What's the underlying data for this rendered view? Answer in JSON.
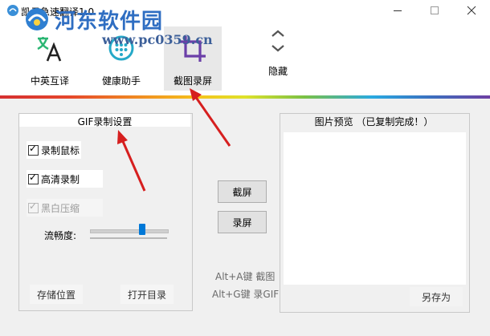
{
  "window": {
    "title": "凯云急速翻译1.0",
    "watermark_text": "河东软件园",
    "watermark_url": "www.pc0359.cn"
  },
  "toolbar": {
    "translate_label": "中英互译",
    "health_label": "健康助手",
    "capture_label": "截图录屏",
    "hide_label": "隐藏"
  },
  "gif_settings": {
    "title": "GIF录制设置",
    "record_mouse": {
      "label": "录制鼠标",
      "checked": true,
      "enabled": true
    },
    "hd_record": {
      "label": "高清录制",
      "checked": true,
      "enabled": true
    },
    "bw_compress": {
      "label": "黑白压缩",
      "checked": true,
      "enabled": false
    },
    "smoothness_label": "流畅度:",
    "smoothness_fraction": 0.66,
    "save_location_label": "存储位置",
    "open_dir_label": "打开目录"
  },
  "actions": {
    "capture_label": "截屏",
    "record_label": "录屏",
    "hotkey_capture": "Alt+A键 截图",
    "hotkey_record": "Alt+G键 录GIF"
  },
  "preview": {
    "title": "图片预览 （已复制完成！）",
    "save_as_label": "另存为"
  },
  "colors": {
    "accent_blue": "#0078d7",
    "arrow_red": "#d61f1f",
    "capture_icon_purple": "#6b3fa8",
    "translate_icon_green": "#2bb673",
    "health_icon_teal": "#25a9c8"
  }
}
